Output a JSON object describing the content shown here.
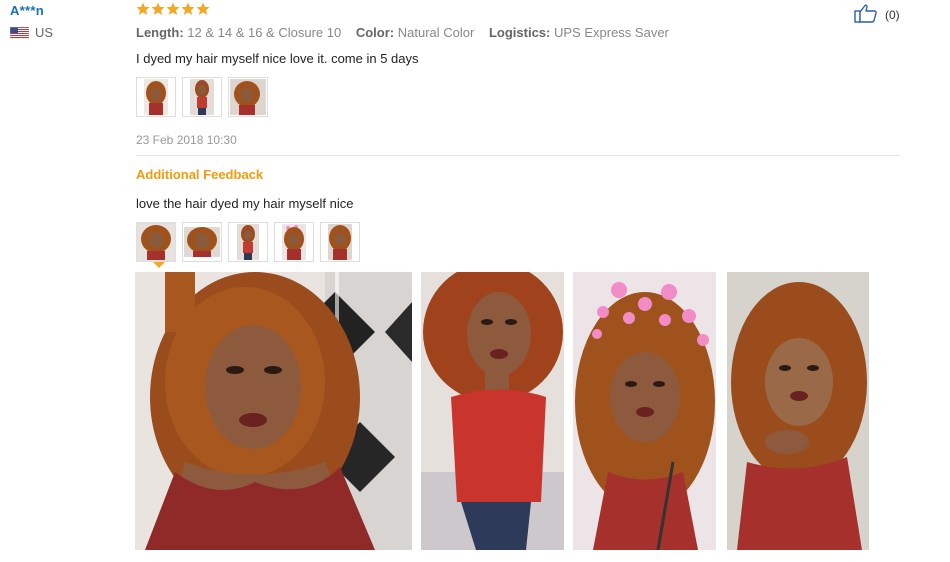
{
  "reviewer": {
    "name": "A***n",
    "country": "US"
  },
  "review": {
    "rating": 5,
    "likes_count": "(0)",
    "attributes": [
      {
        "key": "Length:",
        "value": "12 & 14 & 16 & Closure 10"
      },
      {
        "key": "Color:",
        "value": "Natural Color"
      },
      {
        "key": "Logistics:",
        "value": "UPS Express Saver"
      }
    ],
    "text": "I dyed my hair myself nice love it. come in 5 days",
    "thumbnail_count": 3,
    "date": "23 Feb 2018 10:30"
  },
  "additional_feedback": {
    "label": "Additional Feedback",
    "text": "love the hair dyed my hair myself nice",
    "thumbnail_count": 5,
    "selected_thumbnail": 1,
    "photo_count": 4
  },
  "colors": {
    "star": "#f5a623",
    "accent": "#f29b0b",
    "name_link": "#1a6fb8",
    "hair": "#a0521c",
    "top": "#a6302c"
  }
}
